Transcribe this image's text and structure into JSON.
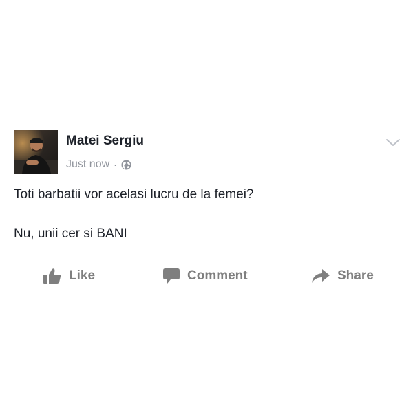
{
  "post": {
    "author": "Matei Sergiu",
    "timestamp": "Just now",
    "separator": "·",
    "privacy_icon": "globe-icon",
    "menu_icon": "chevron-down-icon",
    "body_lines": [
      "Toti barbatii vor acelasi lucru de la femei?",
      "Nu, unii cer si BANI"
    ]
  },
  "actions": {
    "like_label": "Like",
    "like_icon": "thumbs-up-icon",
    "comment_label": "Comment",
    "comment_icon": "speech-bubble-icon",
    "share_label": "Share",
    "share_icon": "share-arrow-icon"
  },
  "colors": {
    "text": "#1d2129",
    "meta": "#90949c",
    "action": "#7f7f7f",
    "divider": "#dddfe2"
  }
}
